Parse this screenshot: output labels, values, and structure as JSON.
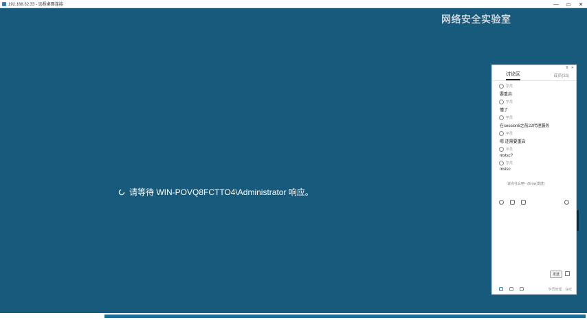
{
  "window": {
    "title": "192.168.32.33 - 远程桌面连接",
    "minimize_glyph": "—",
    "maximize_glyph": "▭",
    "close_glyph": "✕"
  },
  "desktop": {
    "wait_message": "请等待 WIN-POVQ8FCTTO4\\Administrator 响应。",
    "watermark_text": "网络安全实验室"
  },
  "chat_panel": {
    "topbar_pin": "⊼",
    "topbar_close": "✕",
    "tab_active": "讨论区",
    "tab_other": "成员(33)",
    "messages": [
      {
        "user": "学员",
        "text": "要重启"
      },
      {
        "user": "学员",
        "text": "懂了"
      },
      {
        "user": "学员",
        "text": "在session5之前22代理服务"
      },
      {
        "user": "学员",
        "text": "嗯 还需要重启"
      },
      {
        "user": "学员",
        "text": "mstsc?"
      },
      {
        "user": "学员",
        "text": "mstsc"
      }
    ],
    "input_placeholder": "说点什么吧~ (Enter发送)",
    "send_label": "发送",
    "footer_caption": "学员管理 · 在线"
  },
  "colors": {
    "desktop_bg": "#175a7c",
    "panel_bg": "#ffffff",
    "accent": "#3a7fc0"
  }
}
